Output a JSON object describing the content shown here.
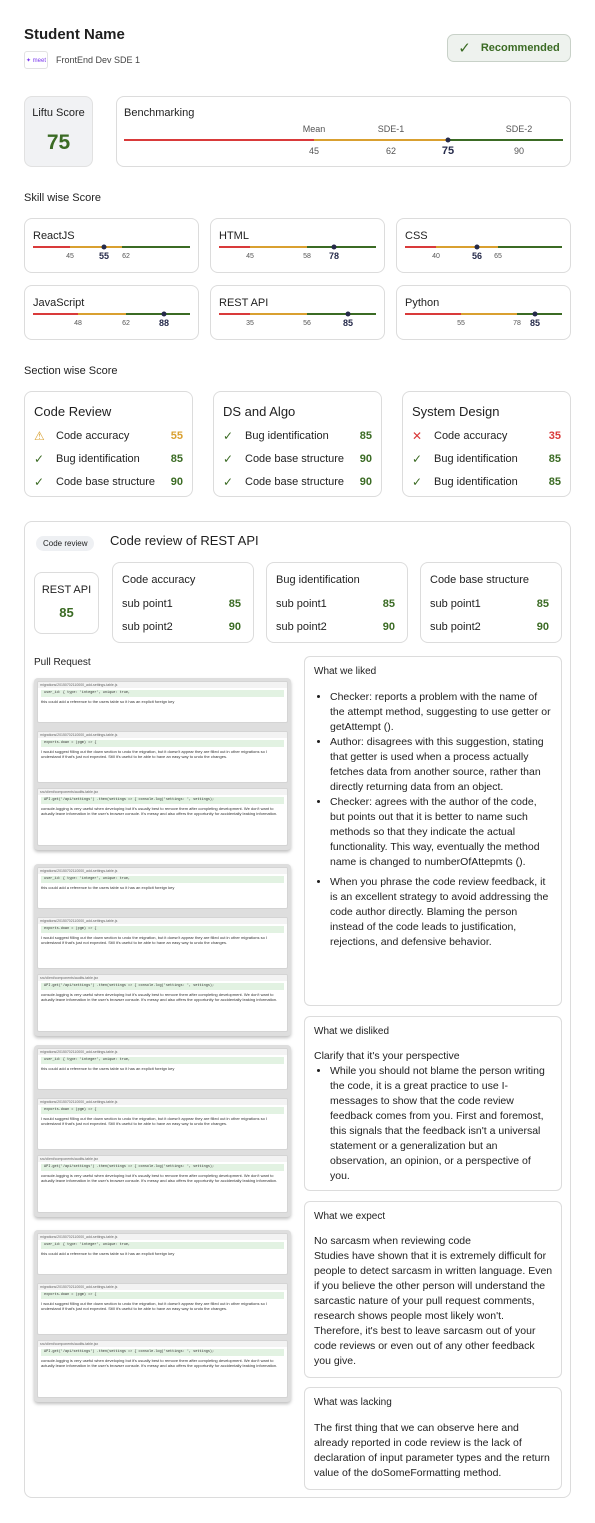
{
  "header": {
    "student_name": "Student Name",
    "role": "FrontEnd Dev SDE 1",
    "logo_text": "✦ meet",
    "recommended_label": "Recommended"
  },
  "liftu": {
    "label": "Liftu Score",
    "value": "75"
  },
  "benchmark": {
    "title": "Benchmarking",
    "labels": [
      "Mean",
      "SDE-1",
      "SDE-2"
    ],
    "values": [
      "45",
      "62",
      "75",
      "90"
    ]
  },
  "skill_title": "Skill wise Score",
  "skills": [
    {
      "name": "ReactJS",
      "low": "45",
      "score": "55",
      "high": "62"
    },
    {
      "name": "HTML",
      "low": "45",
      "mid": "58",
      "score": "78"
    },
    {
      "name": "CSS",
      "low": "40",
      "score": "56",
      "high": "65"
    },
    {
      "name": "JavaScript",
      "low": "48",
      "mid": "62",
      "score": "88"
    },
    {
      "name": "REST API",
      "low": "35",
      "mid": "56",
      "score": "85"
    },
    {
      "name": "Python",
      "low": "55",
      "mid": "78",
      "score": "85"
    }
  ],
  "section_title": "Section wise Score",
  "sections": [
    {
      "title": "Code Review",
      "rows": [
        {
          "icon": "⚠",
          "label": "Code accuracy",
          "score": "55",
          "color": "orange"
        },
        {
          "icon": "✓",
          "label": "Bug identification",
          "score": "85",
          "color": "green"
        },
        {
          "icon": "✓",
          "label": "Code base structure",
          "score": "90",
          "color": "green"
        }
      ]
    },
    {
      "title": "DS and Algo",
      "rows": [
        {
          "icon": "✓",
          "label": "Bug identification",
          "score": "85",
          "color": "green"
        },
        {
          "icon": "✓",
          "label": "Code base structure",
          "score": "90",
          "color": "green"
        },
        {
          "icon": "✓",
          "label": "Code base structure",
          "score": "90",
          "color": "green"
        }
      ]
    },
    {
      "title": "System Design",
      "rows": [
        {
          "icon": "✕",
          "label": "Code accuracy",
          "score": "35",
          "color": "red"
        },
        {
          "icon": "✓",
          "label": "Bug identification",
          "score": "85",
          "color": "green"
        },
        {
          "icon": "✓",
          "label": "Bug identification",
          "score": "85",
          "color": "green"
        }
      ]
    }
  ],
  "code_review": {
    "tag": "Code review",
    "title": "Code review of REST API",
    "api": {
      "label": "REST API",
      "score": "85"
    },
    "subs": [
      {
        "title": "Code accuracy",
        "p1": "sub point1",
        "s1": "85",
        "p2": "sub point2",
        "s2": "90"
      },
      {
        "title": "Bug identification",
        "p1": "sub point1",
        "s1": "85",
        "p2": "sub point2",
        "s2": "90"
      },
      {
        "title": "Code base structure",
        "p1": "sub point1",
        "s1": "85",
        "p2": "sub point2",
        "s2": "90"
      }
    ],
    "pr_title": "Pull Request",
    "snippet": {
      "f1": "migrations/20150702110000_add-settings-table.js",
      "c1": "user_id: {  type: 'integer',  unique: true,",
      "m1": "this could add a reference to the users table so it has an explicit foreign key",
      "c2": "exports.down = (pgm) => {",
      "m2": "I would suggest filling out the down section to undo the migration, but it doesn't appear they are filled out in other migrations so I understand if that's just not expected. Still it's useful to be able to have an easy way to undo the changes.",
      "f3": "src/client/components/audits-table.jsx",
      "c3": "API.get('/api/settings')  .then(settings => {  console.log('settings: ', settings);",
      "m3": "console.logging is very useful when developing but it's usually best to remove them after completing development. We don't want to actually leave information in the user's browser console. It's messy and also offers the opportunity for accidentally leaking information."
    },
    "liked": {
      "title": "What we liked",
      "items": [
        "Checker: reports a problem with the name of the attempt method, suggesting to use getter or getAttempt ().",
        "Author: disagrees with this suggestion, stating that getter is used when a process actually fetches data from another source, rather than directly returning data from an object.",
        "Checker: agrees with the author of the code, but points out that it is better to name such methods so that they indicate the actual functionality. This way, eventually the method name is changed to numberOfAttepmts ().",
        "When you phrase the code review feedback, it is an excellent strategy to avoid addressing the code author directly. Blaming the person instead of the code leads to justification, rejections, and defensive behavior."
      ]
    },
    "disliked": {
      "title": "What we disliked",
      "intro": "Clarify that it's your perspective",
      "items": [
        "While you should not blame the person writing the code, it is a great practice to use I-messages to show that the code review feedback comes from you. First and foremost, this signals that the feedback isn't a universal statement or a generalization but an observation, an opinion, or a perspective of you."
      ]
    },
    "expect": {
      "title": "What we expect",
      "heading": "No sarcasm when reviewing code",
      "text": "Studies have shown that it is extremely difficult for people to detect sarcasm in written language. Even if you believe the other person will understand the sarcastic nature of your pull request comments, research shows people most likely won't. Therefore, it's best to leave sarcasm out of your code reviews or even out of any other feedback you give."
    },
    "lacking": {
      "title": "What was lacking",
      "text": "The first thing that we can observe here and already reported in code review is the lack of declaration of input parameter types and the return value of the doSomeFormatting method."
    }
  },
  "colors": {
    "green": "#3b6b24",
    "orange": "#d9a030",
    "red": "#d93a3a",
    "navy": "#252a4a"
  }
}
